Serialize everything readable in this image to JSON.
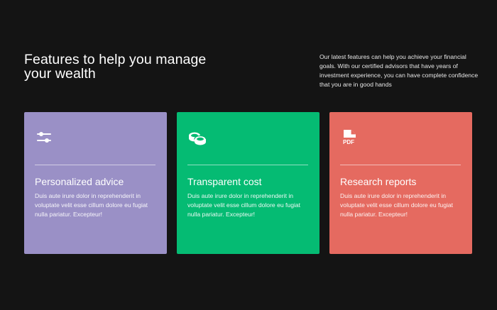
{
  "hero": {
    "heading": "Features to help you manage your wealth",
    "intro": "Our latest features can help you achieve your financial goals. With our certified advisors that have years of investment experience, you can have complete confidence that you are in good hands"
  },
  "colors": {
    "background": "#141414",
    "card_purple": "#9a90c6",
    "card_green": "#05bb73",
    "card_red": "#e56a60"
  },
  "features": [
    {
      "icon": "sliders-icon",
      "title": "Personalized advice",
      "body": "Duis aute irure dolor in reprehenderit in voluptate velit esse cillum dolore eu fugiat nulla pariatur. Excepteur!"
    },
    {
      "icon": "coins-icon",
      "title": "Transparent cost",
      "body": "Duis aute irure dolor in reprehenderit in voluptate velit esse cillum dolore eu fugiat nulla pariatur. Excepteur!"
    },
    {
      "icon": "pdf-file-icon",
      "icon_text": "PDF",
      "title": "Research reports",
      "body": "Duis aute irure dolor in reprehenderit in voluptate velit esse cillum dolore eu fugiat nulla pariatur. Excepteur!"
    }
  ]
}
